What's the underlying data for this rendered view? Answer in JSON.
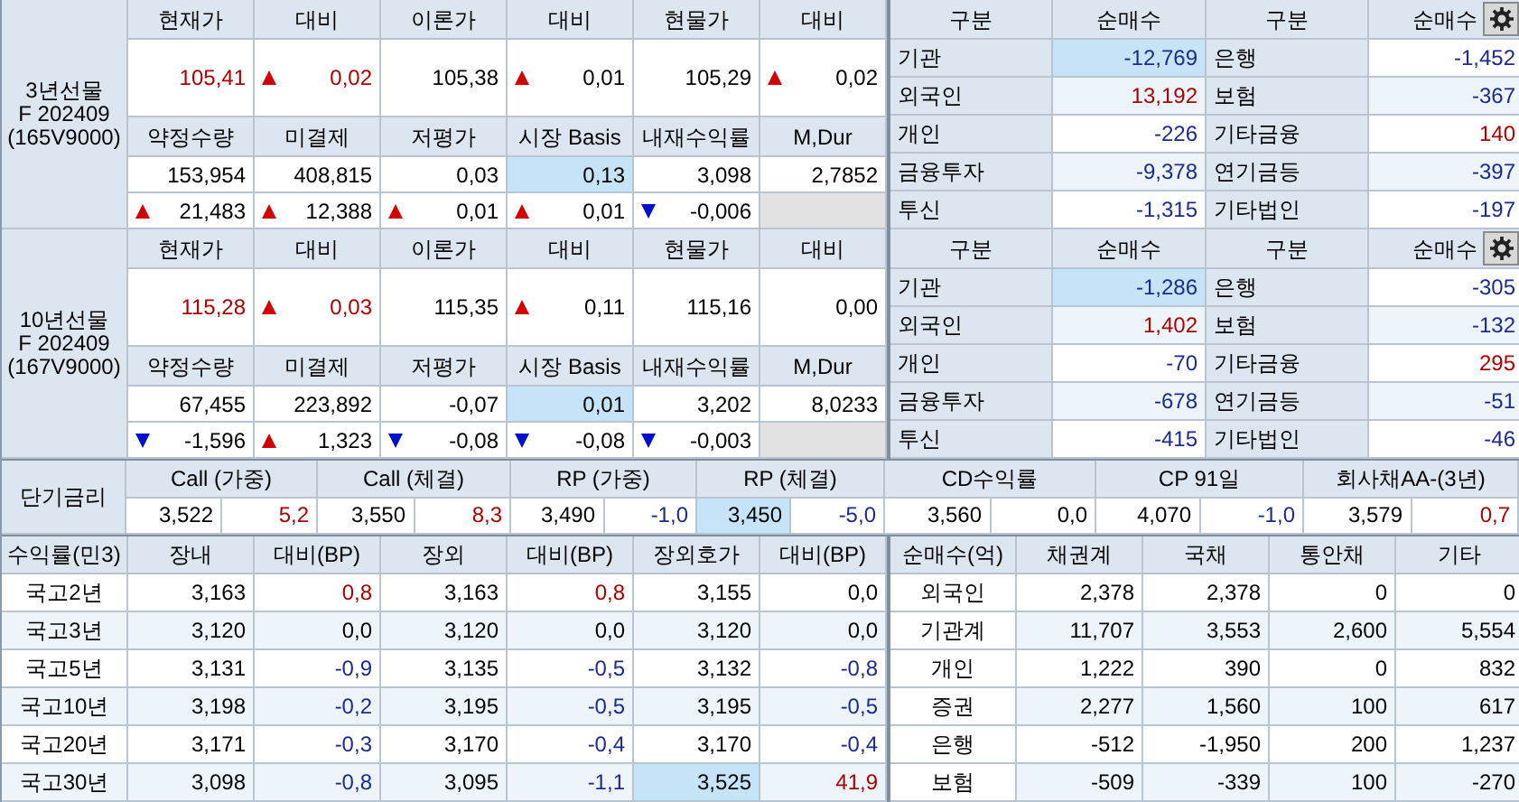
{
  "futures": [
    {
      "label_lines": [
        "3년선물",
        "F 202409",
        "(165V9000)"
      ],
      "headers_1": [
        "현재가",
        "대비",
        "이론가",
        "대비",
        "현물가",
        "대비"
      ],
      "values_1": [
        {
          "text": "105,41",
          "color": "#a80000",
          "kind": "plain"
        },
        {
          "text": "0,02",
          "color": "#a80000",
          "kind": "rise"
        },
        {
          "text": "105,38",
          "color": "#000000",
          "kind": "plain"
        },
        {
          "text": "0,01",
          "color": "#000000",
          "kind": "rise"
        },
        {
          "text": "105,29",
          "color": "#000000",
          "kind": "plain"
        },
        {
          "text": "0,02",
          "color": "#000000",
          "kind": "rise"
        }
      ],
      "headers_2": [
        "약정수량",
        "미결제",
        "저평가",
        "시장 Basis",
        "내재수익률",
        "M,Dur"
      ],
      "values_2": [
        {
          "text": "153,954",
          "color": "#000000",
          "highlighted": false
        },
        {
          "text": "408,815",
          "color": "#000000",
          "highlighted": false
        },
        {
          "text": "0,03",
          "color": "#000000",
          "highlighted": false
        },
        {
          "text": "0,13",
          "color": "#000000",
          "highlighted": true
        },
        {
          "text": "3,098",
          "color": "#000000",
          "highlighted": false
        },
        {
          "text": "2,7852",
          "color": "#000000",
          "highlighted": false
        }
      ],
      "changes": [
        {
          "text": "21,483",
          "color": "#000000",
          "kind": "rise"
        },
        {
          "text": "12,388",
          "color": "#000000",
          "kind": "rise"
        },
        {
          "text": "0,01",
          "color": "#000000",
          "kind": "rise"
        },
        {
          "text": "0,01",
          "color": "#000000",
          "kind": "rise"
        },
        {
          "text": "-0,006",
          "color": "#000000",
          "kind": "fall"
        }
      ]
    },
    {
      "label_lines": [
        "10년선물",
        "F 202409",
        "(167V9000)"
      ],
      "headers_1": [
        "현재가",
        "대비",
        "이론가",
        "대비",
        "현물가",
        "대비"
      ],
      "values_1": [
        {
          "text": "115,28",
          "color": "#a80000",
          "kind": "plain"
        },
        {
          "text": "0,03",
          "color": "#a80000",
          "kind": "rise"
        },
        {
          "text": "115,35",
          "color": "#000000",
          "kind": "plain"
        },
        {
          "text": "0,11",
          "color": "#000000",
          "kind": "rise"
        },
        {
          "text": "115,16",
          "color": "#000000",
          "kind": "plain"
        },
        {
          "text": "0,00",
          "color": "#000000",
          "kind": "plain"
        }
      ],
      "headers_2": [
        "약정수량",
        "미결제",
        "저평가",
        "시장 Basis",
        "내재수익률",
        "M,Dur"
      ],
      "values_2": [
        {
          "text": "67,455",
          "color": "#000000",
          "highlighted": false
        },
        {
          "text": "223,892",
          "color": "#000000",
          "highlighted": false
        },
        {
          "text": "-0,07",
          "color": "#000000",
          "highlighted": false
        },
        {
          "text": "0,01",
          "color": "#000000",
          "highlighted": true
        },
        {
          "text": "3,202",
          "color": "#000000",
          "highlighted": false
        },
        {
          "text": "8,0233",
          "color": "#000000",
          "highlighted": false
        }
      ],
      "changes": [
        {
          "text": "-1,596",
          "color": "#000000",
          "kind": "fall"
        },
        {
          "text": "1,323",
          "color": "#000000",
          "kind": "rise"
        },
        {
          "text": "-0,08",
          "color": "#000000",
          "kind": "fall"
        },
        {
          "text": "-0,08",
          "color": "#000000",
          "kind": "fall"
        },
        {
          "text": "-0,003",
          "color": "#000000",
          "kind": "fall"
        }
      ]
    }
  ],
  "investors": [
    {
      "columns": [
        "구분",
        "순매수",
        "구분",
        "순매수"
      ],
      "rows": [
        {
          "group_a": "기관",
          "net_a": {
            "text": "-12,769",
            "color": "#1c2a8e",
            "highlighted": true
          },
          "group_b": "은행",
          "net_b": {
            "text": "-1,452",
            "color": "#1c2a8e",
            "highlighted": false
          }
        },
        {
          "group_a": "외국인",
          "net_a": {
            "text": "13,192",
            "color": "#a80000",
            "highlighted": false
          },
          "group_b": "보험",
          "net_b": {
            "text": "-367",
            "color": "#1c2a8e",
            "highlighted": false
          }
        },
        {
          "group_a": "개인",
          "net_a": {
            "text": "-226",
            "color": "#1c2a8e",
            "highlighted": false
          },
          "group_b": "기타금융",
          "net_b": {
            "text": "140",
            "color": "#a80000",
            "highlighted": false
          }
        },
        {
          "group_a": "금융투자",
          "net_a": {
            "text": "-9,378",
            "color": "#1c2a8e",
            "highlighted": false
          },
          "group_b": "연기금등",
          "net_b": {
            "text": "-397",
            "color": "#1c2a8e",
            "highlighted": false
          }
        },
        {
          "group_a": "투신",
          "net_a": {
            "text": "-1,315",
            "color": "#1c2a8e",
            "highlighted": false
          },
          "group_b": "기타법인",
          "net_b": {
            "text": "-197",
            "color": "#1c2a8e",
            "highlighted": false
          }
        }
      ]
    },
    {
      "columns": [
        "구분",
        "순매수",
        "구분",
        "순매수"
      ],
      "rows": [
        {
          "group_a": "기관",
          "net_a": {
            "text": "-1,286",
            "color": "#1c2a8e",
            "highlighted": true
          },
          "group_b": "은행",
          "net_b": {
            "text": "-305",
            "color": "#1c2a8e",
            "highlighted": false
          }
        },
        {
          "group_a": "외국인",
          "net_a": {
            "text": "1,402",
            "color": "#a80000",
            "highlighted": false
          },
          "group_b": "보험",
          "net_b": {
            "text": "-132",
            "color": "#1c2a8e",
            "highlighted": false
          }
        },
        {
          "group_a": "개인",
          "net_a": {
            "text": "-70",
            "color": "#1c2a8e",
            "highlighted": false
          },
          "group_b": "기타금융",
          "net_b": {
            "text": "295",
            "color": "#a80000",
            "highlighted": false
          }
        },
        {
          "group_a": "금융투자",
          "net_a": {
            "text": "-678",
            "color": "#1c2a8e",
            "highlighted": false
          },
          "group_b": "연기금등",
          "net_b": {
            "text": "-51",
            "color": "#1c2a8e",
            "highlighted": false
          }
        },
        {
          "group_a": "투신",
          "net_a": {
            "text": "-415",
            "color": "#1c2a8e",
            "highlighted": false
          },
          "group_b": "기타법인",
          "net_b": {
            "text": "-46",
            "color": "#1c2a8e",
            "highlighted": false
          }
        }
      ]
    }
  ],
  "short_rates": {
    "label": "단기금리",
    "groups": [
      {
        "label": "Call (가중)",
        "rate": {
          "text": "3,522",
          "color": "#000000",
          "highlighted": false
        },
        "change": {
          "text": "5,2",
          "color": "#a80000"
        }
      },
      {
        "label": "Call (체결)",
        "rate": {
          "text": "3,550",
          "color": "#000000",
          "highlighted": false
        },
        "change": {
          "text": "8,3",
          "color": "#a80000"
        }
      },
      {
        "label": "RP (가중)",
        "rate": {
          "text": "3,490",
          "color": "#000000",
          "highlighted": false
        },
        "change": {
          "text": "-1,0",
          "color": "#1c2a8e"
        }
      },
      {
        "label": "RP (체결)",
        "rate": {
          "text": "3,450",
          "color": "#000000",
          "highlighted": true
        },
        "change": {
          "text": "-5,0",
          "color": "#1c2a8e"
        }
      },
      {
        "label": "CD수익률",
        "rate": {
          "text": "3,560",
          "color": "#000000",
          "highlighted": false
        },
        "change": {
          "text": "0,0",
          "color": "#000000"
        }
      },
      {
        "label": "CP 91일",
        "rate": {
          "text": "4,070",
          "color": "#000000",
          "highlighted": false
        },
        "change": {
          "text": "-1,0",
          "color": "#1c2a8e"
        }
      },
      {
        "label": "회사채AA-(3년)",
        "rate": {
          "text": "3,579",
          "color": "#000000",
          "highlighted": false
        },
        "change": {
          "text": "0,7",
          "color": "#a80000"
        }
      }
    ]
  },
  "yields": {
    "corner": "수익률(민3)",
    "columns": [
      "장내",
      "대비(BP)",
      "장외",
      "대비(BP)",
      "장외호가",
      "대비(BP)"
    ],
    "rows": [
      {
        "name": "국고2년",
        "cells": [
          {
            "text": "3,163",
            "color": "#000000",
            "highlighted": false
          },
          {
            "text": "0,8",
            "color": "#a80000",
            "highlighted": false
          },
          {
            "text": "3,163",
            "color": "#000000",
            "highlighted": false
          },
          {
            "text": "0,8",
            "color": "#a80000",
            "highlighted": false
          },
          {
            "text": "3,155",
            "color": "#000000",
            "highlighted": false
          },
          {
            "text": "0,0",
            "color": "#000000",
            "highlighted": false
          }
        ]
      },
      {
        "name": "국고3년",
        "cells": [
          {
            "text": "3,120",
            "color": "#000000",
            "highlighted": false
          },
          {
            "text": "0,0",
            "color": "#000000",
            "highlighted": false
          },
          {
            "text": "3,120",
            "color": "#000000",
            "highlighted": false
          },
          {
            "text": "0,0",
            "color": "#000000",
            "highlighted": false
          },
          {
            "text": "3,120",
            "color": "#000000",
            "highlighted": false
          },
          {
            "text": "0,0",
            "color": "#000000",
            "highlighted": false
          }
        ]
      },
      {
        "name": "국고5년",
        "cells": [
          {
            "text": "3,131",
            "color": "#000000",
            "highlighted": false
          },
          {
            "text": "-0,9",
            "color": "#1c2a8e",
            "highlighted": false
          },
          {
            "text": "3,135",
            "color": "#000000",
            "highlighted": false
          },
          {
            "text": "-0,5",
            "color": "#1c2a8e",
            "highlighted": false
          },
          {
            "text": "3,132",
            "color": "#000000",
            "highlighted": false
          },
          {
            "text": "-0,8",
            "color": "#1c2a8e",
            "highlighted": false
          }
        ]
      },
      {
        "name": "국고10년",
        "cells": [
          {
            "text": "3,198",
            "color": "#000000",
            "highlighted": false
          },
          {
            "text": "-0,2",
            "color": "#1c2a8e",
            "highlighted": false
          },
          {
            "text": "3,195",
            "color": "#000000",
            "highlighted": false
          },
          {
            "text": "-0,5",
            "color": "#1c2a8e",
            "highlighted": false
          },
          {
            "text": "3,195",
            "color": "#000000",
            "highlighted": false
          },
          {
            "text": "-0,5",
            "color": "#1c2a8e",
            "highlighted": false
          }
        ]
      },
      {
        "name": "국고20년",
        "cells": [
          {
            "text": "3,171",
            "color": "#000000",
            "highlighted": false
          },
          {
            "text": "-0,3",
            "color": "#1c2a8e",
            "highlighted": false
          },
          {
            "text": "3,170",
            "color": "#000000",
            "highlighted": false
          },
          {
            "text": "-0,4",
            "color": "#1c2a8e",
            "highlighted": false
          },
          {
            "text": "3,170",
            "color": "#000000",
            "highlighted": false
          },
          {
            "text": "-0,4",
            "color": "#1c2a8e",
            "highlighted": false
          }
        ]
      },
      {
        "name": "국고30년",
        "cells": [
          {
            "text": "3,098",
            "color": "#000000",
            "highlighted": false
          },
          {
            "text": "-0,8",
            "color": "#1c2a8e",
            "highlighted": false
          },
          {
            "text": "3,095",
            "color": "#000000",
            "highlighted": false
          },
          {
            "text": "-1,1",
            "color": "#1c2a8e",
            "highlighted": false
          },
          {
            "text": "3,525",
            "color": "#000000",
            "highlighted": true
          },
          {
            "text": "41,9",
            "color": "#a80000",
            "highlighted": false
          }
        ]
      }
    ]
  },
  "net_buying": {
    "corner": "순매수(억)",
    "columns": [
      "채권계",
      "국채",
      "통안채",
      "기타"
    ],
    "rows": [
      {
        "name": "외국인",
        "values": [
          "2,378",
          "2,378",
          "0",
          "0"
        ]
      },
      {
        "name": "기관계",
        "values": [
          "11,707",
          "3,553",
          "2,600",
          "5,554"
        ]
      },
      {
        "name": "개인",
        "values": [
          "1,222",
          "390",
          "0",
          "832"
        ]
      },
      {
        "name": "증권",
        "values": [
          "2,277",
          "1,560",
          "100",
          "617"
        ]
      },
      {
        "name": "은행",
        "values": [
          "-512",
          "-1,950",
          "200",
          "1,237"
        ]
      },
      {
        "name": "보험",
        "values": [
          "-509",
          "-339",
          "100",
          "-270"
        ]
      }
    ]
  }
}
